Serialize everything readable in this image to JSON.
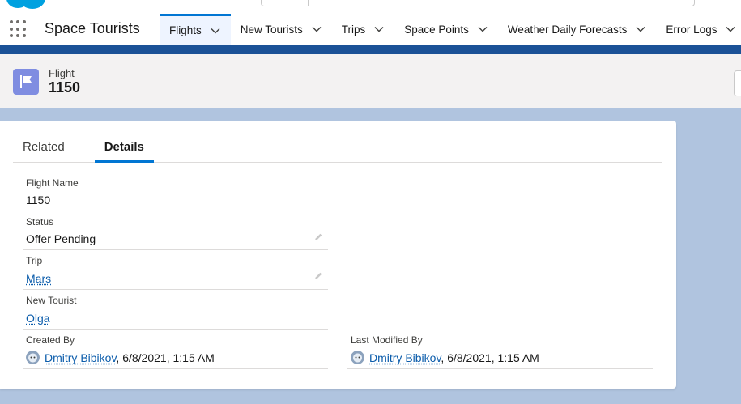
{
  "app": {
    "name": "Space Tourists"
  },
  "nav": {
    "items": [
      {
        "label": "Flights",
        "active": true
      },
      {
        "label": "New Tourists",
        "active": false
      },
      {
        "label": "Trips",
        "active": false
      },
      {
        "label": "Space Points",
        "active": false
      },
      {
        "label": "Weather Daily Forecasts",
        "active": false
      },
      {
        "label": "Error Logs",
        "active": false
      }
    ]
  },
  "record": {
    "object_label": "Flight",
    "title": "1150",
    "icon": "flag-icon"
  },
  "tabs": {
    "related": "Related",
    "details": "Details"
  },
  "fields": {
    "flight_name": {
      "label": "Flight Name",
      "value": "1150"
    },
    "status": {
      "label": "Status",
      "value": "Offer Pending"
    },
    "trip": {
      "label": "Trip",
      "value": "Mars"
    },
    "new_tourist": {
      "label": "New Tourist",
      "value": "Olga"
    },
    "created_by": {
      "label": "Created By",
      "user": "Dmitry Bibikov",
      "date": ", 6/8/2021, 1:15 AM"
    },
    "last_modified_by": {
      "label": "Last Modified By",
      "user": "Dmitry Bibikov",
      "date": ", 6/8/2021, 1:15 AM"
    }
  },
  "colors": {
    "brand": "#1b5297",
    "accent": "#0176d3",
    "record_icon": "#7f8de1",
    "link": "#0b5cab",
    "background": "#b0c4df"
  }
}
